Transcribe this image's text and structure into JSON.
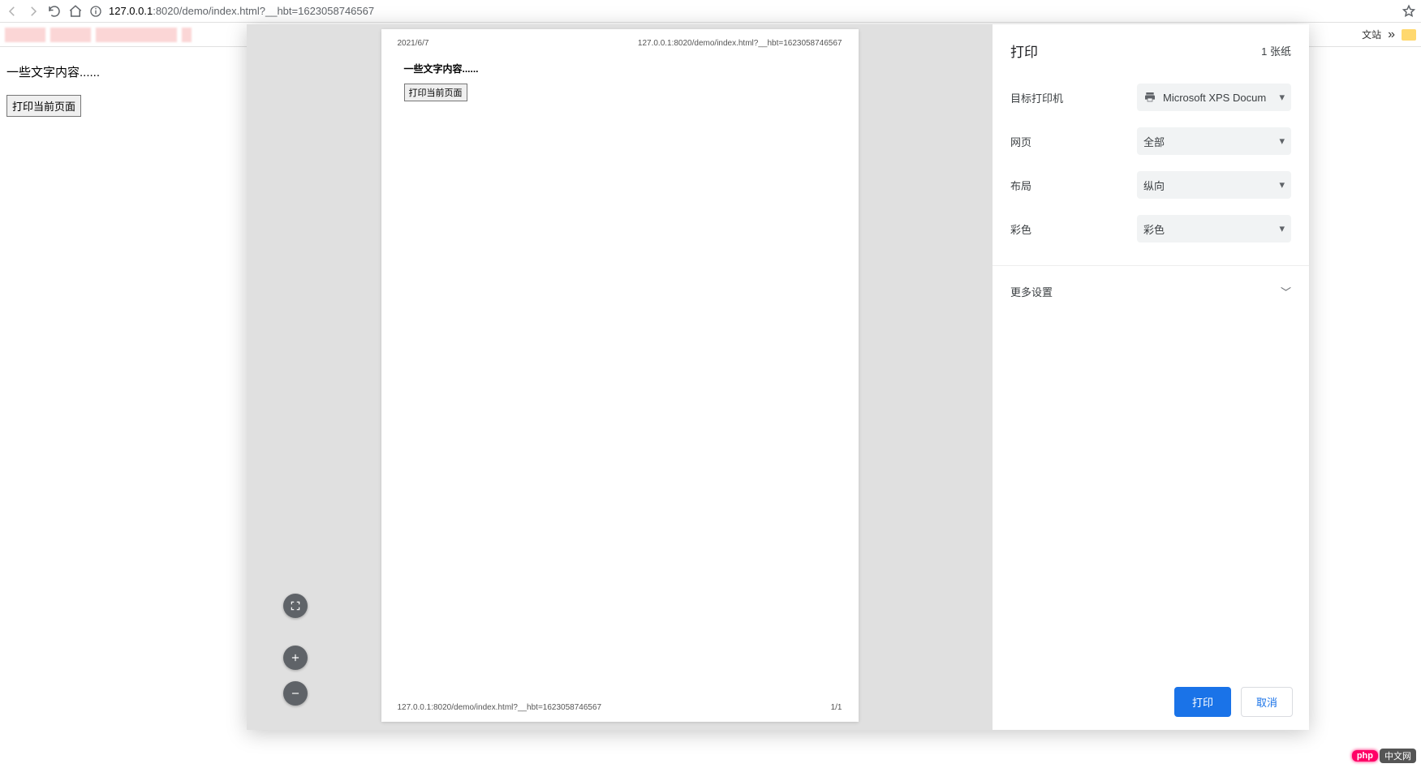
{
  "browser": {
    "url_host": "127.0.0.1",
    "url_port": ":8020",
    "url_path": "/demo/index.html?__hbt=1623058746567"
  },
  "bookmarks": {
    "end_label": "文站"
  },
  "page": {
    "body_text": "一些文字内容......",
    "print_button": "打印当前页面"
  },
  "preview": {
    "date": "2021/6/7",
    "title": "127.0.0.1:8020/demo/index.html?__hbt=1623058746567",
    "body_text": "一些文字内容......",
    "print_button": "打印当前页面",
    "footer_url": "127.0.0.1:8020/demo/index.html?__hbt=1623058746567",
    "page_num": "1/1"
  },
  "print": {
    "title": "打印",
    "sheet_count": "1 张纸",
    "destination_label": "目标打印机",
    "destination_value": "Microsoft XPS Docum",
    "pages_label": "网页",
    "pages_value": "全部",
    "layout_label": "布局",
    "layout_value": "纵向",
    "color_label": "彩色",
    "color_value": "彩色",
    "more_settings": "更多设置",
    "print_btn": "打印",
    "cancel_btn": "取消"
  },
  "watermark": {
    "badge": "php",
    "text": "中文网"
  }
}
